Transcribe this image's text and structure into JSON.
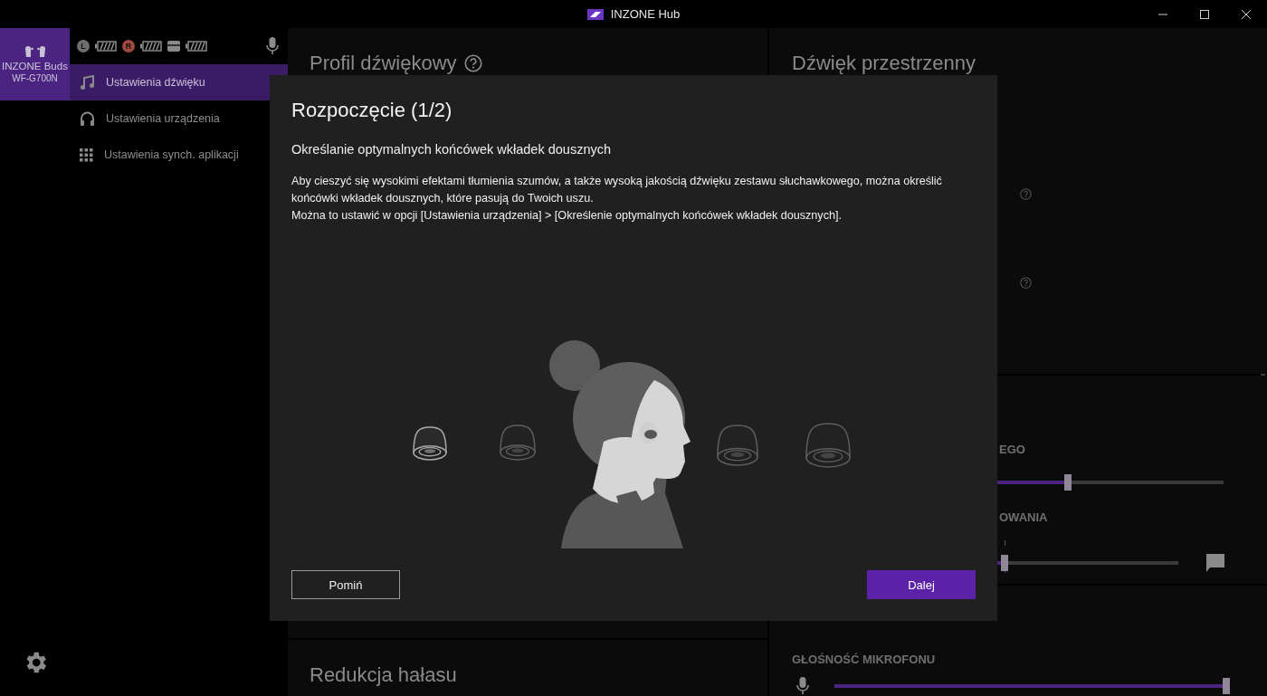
{
  "window": {
    "title": "INZONE Hub"
  },
  "device": {
    "name": "INZONE Buds",
    "model": "WF-G700N",
    "selected": true
  },
  "status": [
    {
      "kind": "badge",
      "label": "L",
      "color": "#6e6e6e"
    },
    {
      "kind": "badge",
      "label": "R",
      "color": "#a0483f"
    },
    {
      "kind": "case"
    }
  ],
  "nav": [
    {
      "label": "Ustawienia dźwięku",
      "kind": "music",
      "selected": true
    },
    {
      "label": "Ustawienia urządzenia",
      "kind": "headphones",
      "selected": false
    },
    {
      "label": "Ustawienia synch. aplikacji",
      "kind": "grid",
      "selected": false
    }
  ],
  "sound_profile": {
    "title": "Profil dźwiękowy"
  },
  "noise_reduction": {
    "title": "Redukcja hałasu"
  },
  "surround": {
    "title": "Dźwięk przestrzenny"
  },
  "sliders": [
    {
      "label": "EGO",
      "level": 0.64,
      "kind": "plain"
    },
    {
      "label": "OWANIA",
      "level": 0.55,
      "kind": "centered"
    }
  ],
  "microphone": {
    "volume_label": "GŁOŚNOŚĆ MIKROFONU",
    "level": 1
  },
  "dialog": {
    "title": "Rozpoczęcie (1/2)",
    "subtitle": "Określanie optymalnych końcówek wkładek dousznych",
    "paragraphs": [
      "Aby cieszyć się wysokimi efektami tłumienia szumów, a także wysoką jakością dźwięku zestawu słuchawkowego, można określić końcówki wkładek dousznych, które pasują do Twoich uszu.",
      "Można to ustawić w opcji [Ustawienia urządzenia] > [Określenie optymalnych końcówek wkładek dousznych]."
    ],
    "ear_tips": [
      {
        "selected": true
      },
      {
        "selected": false
      },
      {
        "selected": false
      },
      {
        "selected": false
      }
    ],
    "buttons": [
      {
        "label": "Pomiń",
        "kind": "secondary"
      },
      {
        "label": "Dalej",
        "kind": "primary"
      }
    ]
  }
}
